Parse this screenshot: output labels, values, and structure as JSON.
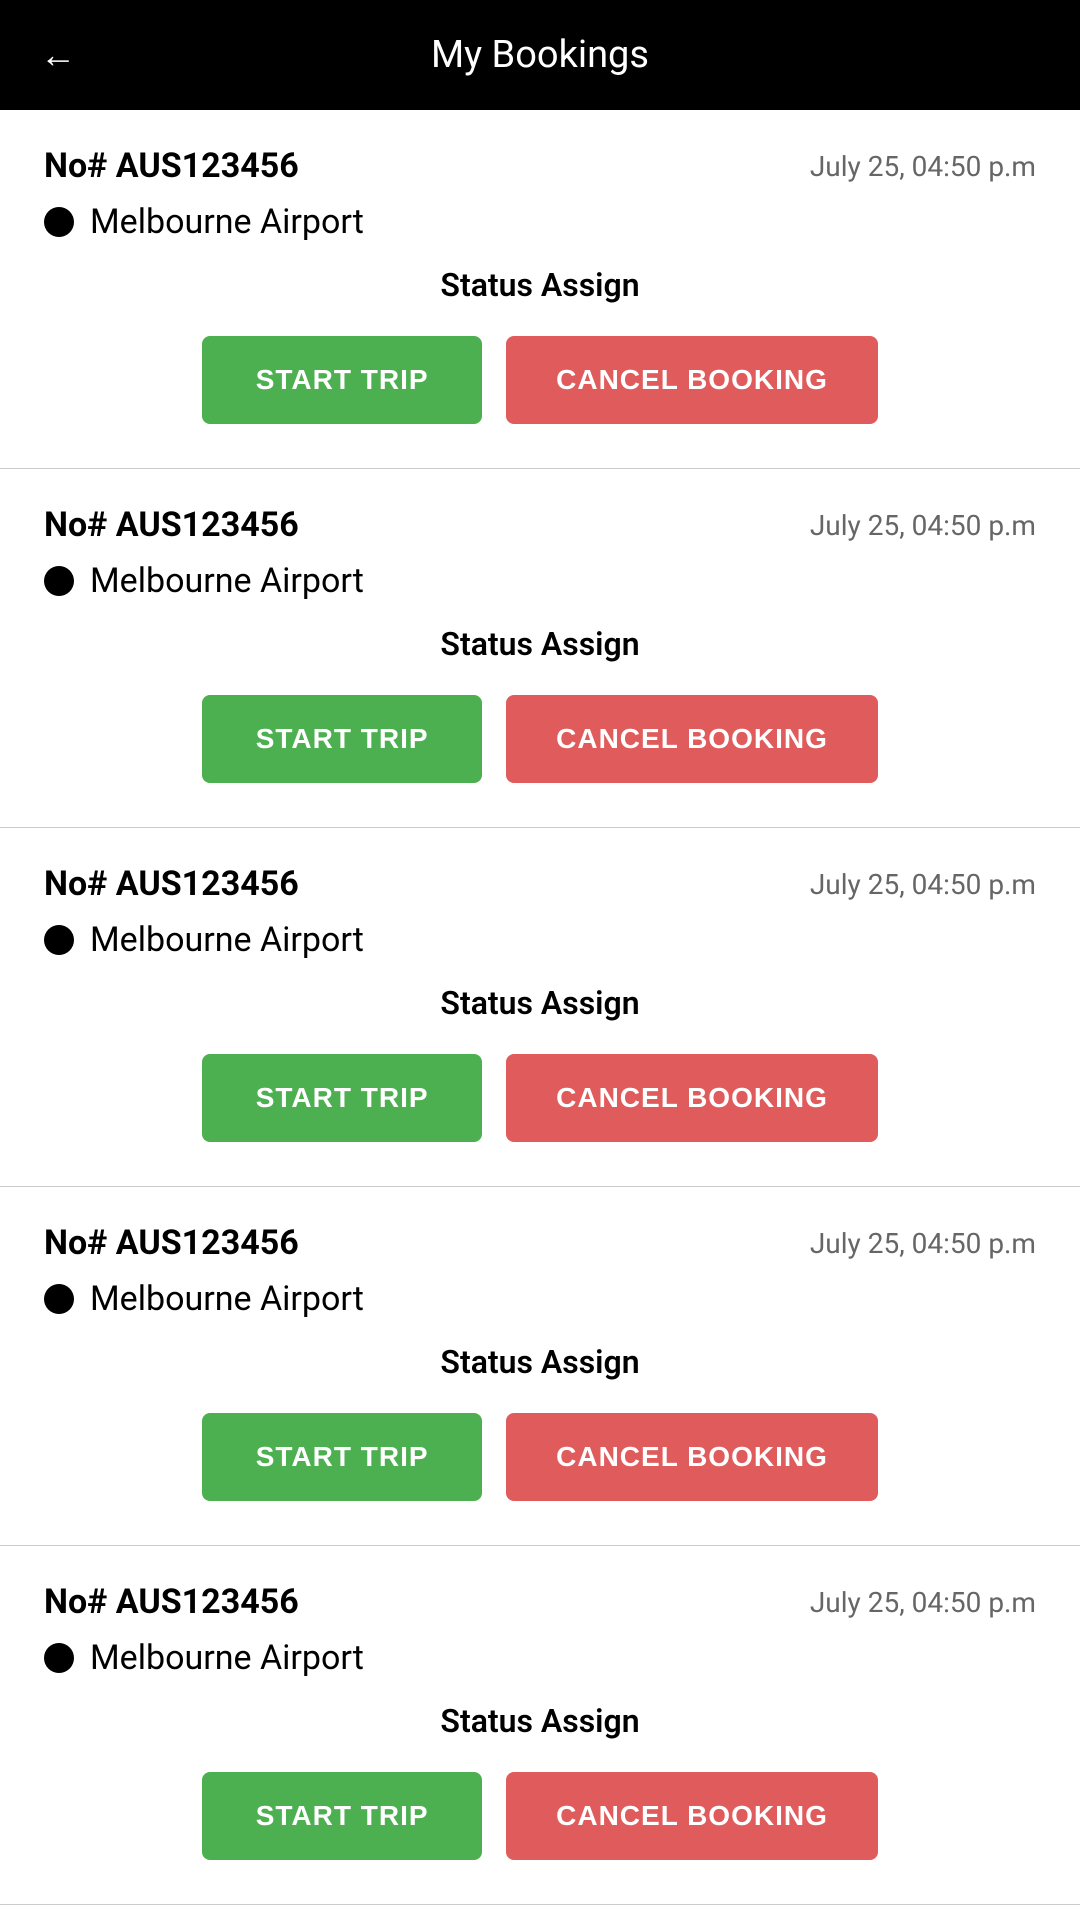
{
  "header": {
    "back_label": "←",
    "title": "My Bookings"
  },
  "bookings": [
    {
      "id": "booking-1",
      "number": "No# AUS123456",
      "datetime": "July 25, 04:50 p.m",
      "location": "Melbourne Airport",
      "status": "Status Assign",
      "start_trip_label": "START TRIP",
      "cancel_booking_label": "CANCEL BOOKING"
    },
    {
      "id": "booking-2",
      "number": "No# AUS123456",
      "datetime": "July 25, 04:50 p.m",
      "location": "Melbourne Airport",
      "status": "Status Assign",
      "start_trip_label": "START TRIP",
      "cancel_booking_label": "CANCEL BOOKING"
    },
    {
      "id": "booking-3",
      "number": "No# AUS123456",
      "datetime": "July 25, 04:50 p.m",
      "location": "Melbourne Airport",
      "status": "Status Assign",
      "start_trip_label": "START TRIP",
      "cancel_booking_label": "CANCEL BOOKING"
    },
    {
      "id": "booking-4",
      "number": "No# AUS123456",
      "datetime": "July 25, 04:50 p.m",
      "location": "Melbourne Airport",
      "status": "Status Assign",
      "start_trip_label": "START TRIP",
      "cancel_booking_label": "CANCEL BOOKING"
    },
    {
      "id": "booking-5",
      "number": "No# AUS123456",
      "datetime": "July 25, 04:50 p.m",
      "location": "Melbourne Airport",
      "status": "Status Assign",
      "start_trip_label": "START TRIP",
      "cancel_booking_label": "CANCEL BOOKING"
    }
  ],
  "colors": {
    "header_bg": "#000000",
    "start_trip_bg": "#4caf50",
    "cancel_booking_bg": "#e05c5c"
  }
}
